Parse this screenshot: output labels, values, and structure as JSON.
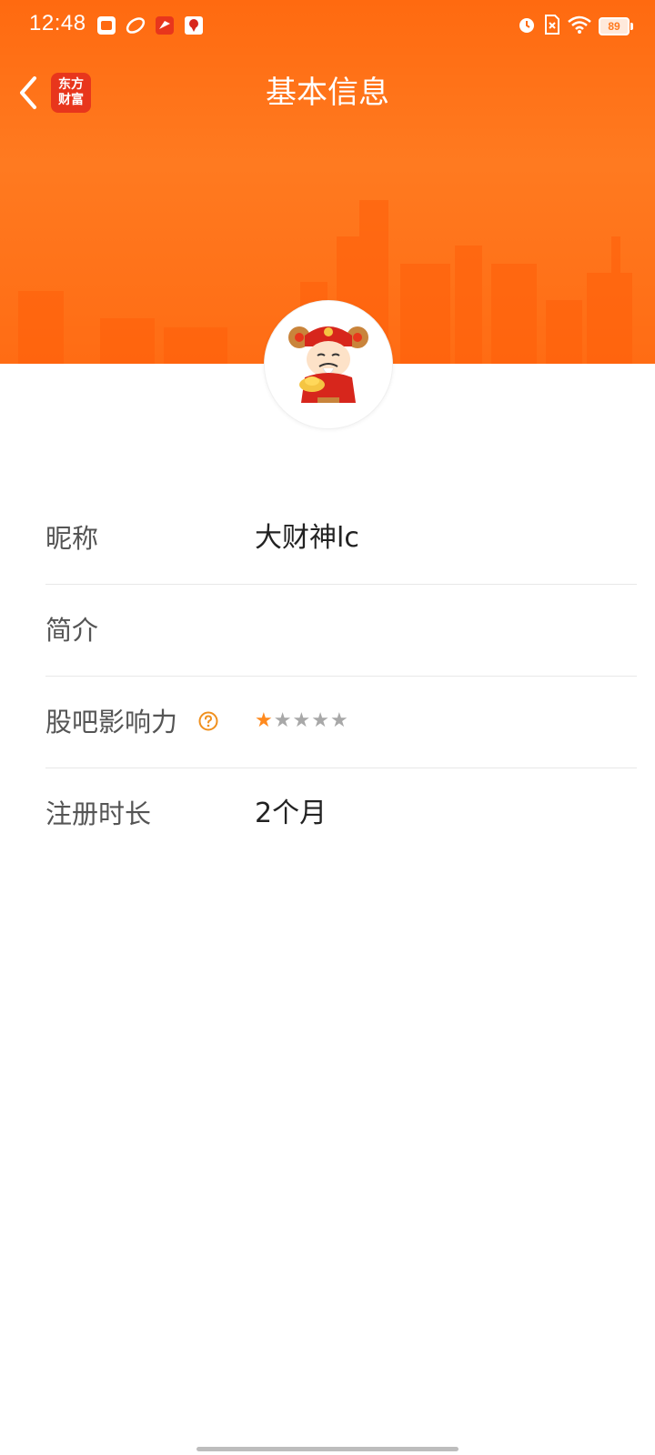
{
  "status_bar": {
    "time": "12:48",
    "battery": "89",
    "left_icons": [
      "xiaohongshu-icon",
      "browser-icon",
      "feishu-icon",
      "map-pin-icon"
    ],
    "right_icons": [
      "alarm-icon",
      "sim-off-icon",
      "wifi-icon",
      "battery-icon"
    ]
  },
  "nav": {
    "title": "基本信息",
    "logo_line1": "东方",
    "logo_line2": "财富",
    "back_icon": "chevron-left-icon"
  },
  "profile": {
    "avatar_icon": "cai-shen-avatar-icon"
  },
  "info_rows": [
    {
      "label": "昵称",
      "value": "大财神lc"
    },
    {
      "label": "简介",
      "value": ""
    },
    {
      "label": "股吧影响力",
      "rating": 1,
      "rating_max": 5
    },
    {
      "label": "注册时长",
      "value": "2个月"
    }
  ],
  "colors": {
    "header_orange": "#ff7a20",
    "accent_star": "#ff8a1e",
    "logo_red": "#e8361c"
  }
}
